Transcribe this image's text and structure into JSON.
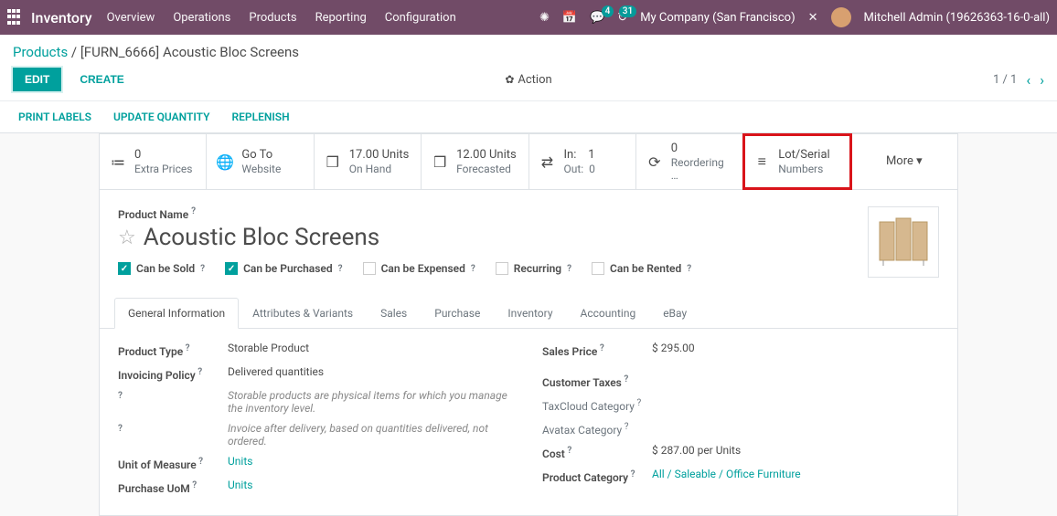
{
  "topbar": {
    "module": "Inventory",
    "menu": [
      "Overview",
      "Operations",
      "Products",
      "Reporting",
      "Configuration"
    ],
    "msg_badge": "4",
    "activity_badge": "31",
    "company": "My Company (San Francisco)",
    "user": "Mitchell Admin (19626363-16-0-all)"
  },
  "crumb": {
    "parent": "Products",
    "current": "[FURN_6666] Acoustic Bloc Screens"
  },
  "buttons": {
    "edit": "EDIT",
    "create": "CREATE",
    "action": "Action"
  },
  "pager": {
    "pos": "1 / 1"
  },
  "subactions": [
    "PRINT LABELS",
    "UPDATE QUANTITY",
    "REPLENISH"
  ],
  "stats": [
    {
      "ico": "≔",
      "line1": "0",
      "line2": "Extra Prices"
    },
    {
      "ico": "🌐",
      "line1": "Go To",
      "line2": "Website"
    },
    {
      "ico": "❒",
      "line1": "17.00 Units",
      "line2": "On Hand"
    },
    {
      "ico": "❒",
      "line1": "12.00 Units",
      "line2": "Forecasted"
    },
    {
      "ico": "⇄",
      "line1": "In:    1",
      "line2": "Out:  0"
    },
    {
      "ico": "⟳",
      "line1": "0",
      "line2": "Reordering …"
    },
    {
      "ico": "≡",
      "line1": "Lot/Serial",
      "line2": "Numbers"
    },
    {
      "ico": "",
      "line1": "More ▾",
      "line2": ""
    }
  ],
  "product": {
    "label": "Product Name",
    "name": "Acoustic Bloc Screens",
    "checks": [
      {
        "label": "Can be Sold",
        "on": true
      },
      {
        "label": "Can be Purchased",
        "on": true
      },
      {
        "label": "Can be Expensed",
        "on": false
      },
      {
        "label": "Recurring",
        "on": false
      },
      {
        "label": "Can be Rented",
        "on": false
      }
    ]
  },
  "tabs": [
    "General Information",
    "Attributes & Variants",
    "Sales",
    "Purchase",
    "Inventory",
    "Accounting",
    "eBay"
  ],
  "left_fields": {
    "type_k": "Product Type",
    "type_v": "Storable Product",
    "inv_k": "Invoicing Policy",
    "inv_v": "Delivered quantities",
    "desc1": "Storable products are physical items for which you manage the inventory level.",
    "desc2": "Invoice after delivery, based on quantities delivered, not ordered.",
    "uom_k": "Unit of Measure",
    "uom_v": "Units",
    "puom_k": "Purchase UoM",
    "puom_v": "Units"
  },
  "right_fields": {
    "price_k": "Sales Price",
    "price_v": "$ 295.00",
    "tax_k": "Customer Taxes",
    "tc_k": "TaxCloud Category",
    "av_k": "Avatax Category",
    "cost_k": "Cost",
    "cost_v": "$ 287.00 per Units",
    "cat_k": "Product Category",
    "cat_v": "All / Saleable / Office Furniture"
  }
}
